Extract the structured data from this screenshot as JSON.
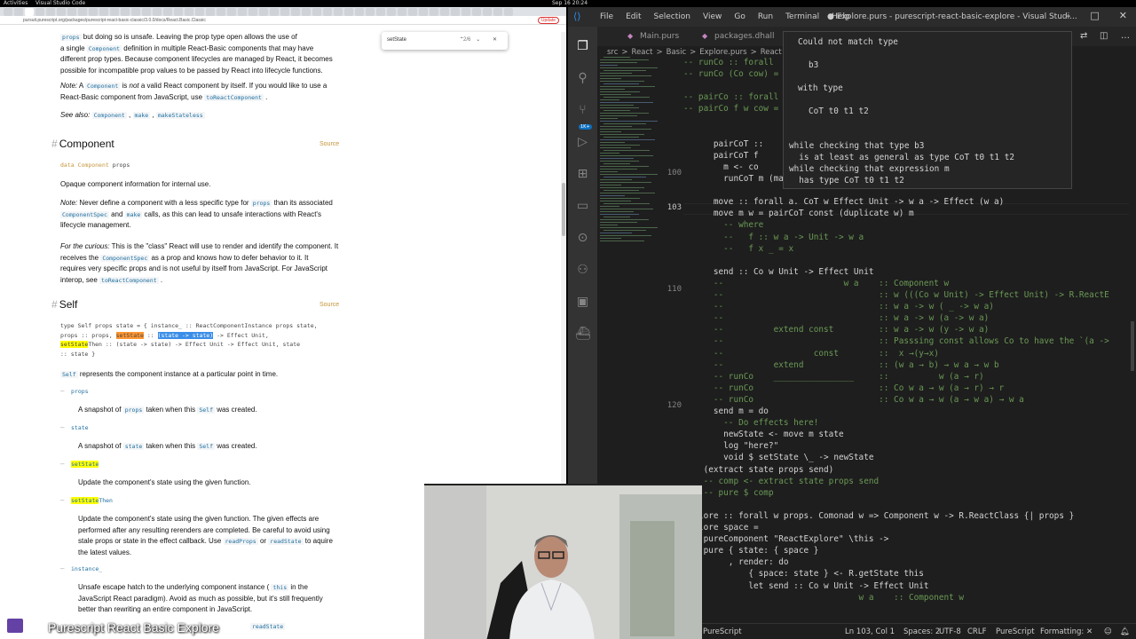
{
  "topbar": {
    "activities": "Activities",
    "app": "Visual Studio Code",
    "clock": "Sep 16 20:24"
  },
  "browser": {
    "url": "pursuit.purescript.org/packages/purescript-react-basic-classic/3.0.0/docs/React.Basic.Classic",
    "update_label": "Update",
    "find": {
      "query": "setState",
      "count": "2/6",
      "controls": "⌃ ⌄ ✕"
    },
    "intro": {
      "line1_pre": "Component ",
      "line1_code": "props",
      "line1_post": " but doing so is unsafe. Leaving the prop type open allows the use of",
      "line2_pre": "a single ",
      "line2_code": "Component",
      "line2_post": " definition in multiple React-Basic components that may have",
      "line3": "different prop types. Because component lifecycles are managed by React, it becomes",
      "line4": "possible for incompatible prop values to be passed by React into lifecycle functions.",
      "note_label": "Note:",
      "note_a": " A ",
      "note_code1": "Component",
      "note_b": " is ",
      "note_not": "not",
      "note_c": " a valid React component by itself. If you would like to use a",
      "note_line2_pre": "React-Basic component from JavaScript, use ",
      "note_code2": "toReactComponent",
      "note_line2_post": " .",
      "seealso_label": "See also:",
      "seealso_1": "Component",
      "seealso_2": "make",
      "seealso_3": "makeStateless"
    },
    "component_section": {
      "heading": "Component",
      "source": "Source",
      "sig_data": "data",
      "sig_name": "Component",
      "sig_arg": "props",
      "desc": "Opaque component information for internal use.",
      "note_label": "Note:",
      "note_l1_pre": " Never define a component with a less specific type for ",
      "note_l1_code": "props",
      "note_l1_post": " than its associated",
      "note_l2_code1": "ComponentSpec",
      "note_l2_mid": " and ",
      "note_l2_code2": "make",
      "note_l2_post": " calls, as this can lead to unsafe interactions with React's",
      "note_l3": "lifecycle management.",
      "curious_label": "For the curious:",
      "curious_l1": " This is the \"class\" React will use to render and identify the component. It",
      "curious_l2_pre": "receives the ",
      "curious_l2_code": "ComponentSpec",
      "curious_l2_post": " as a prop and knows how to defer behavior to it. It",
      "curious_l3": "requires very specific props and is not useful by itself from JavaScript. For JavaScript",
      "curious_l4_pre": "interop, see ",
      "curious_l4_code": "toReactComponent",
      "curious_l4_post": " ."
    },
    "self_section": {
      "heading": "Self",
      "source": "Source",
      "sig_l1": "type Self props state = { instance_ :: ReactComponentInstance props state,",
      "sig_l2_pre": "  props :: props, ",
      "sig_l2_hl": "setState",
      "sig_l2_mid": " :: ",
      "sig_l2_sel": "(state -> state)",
      "sig_l2_post": " -> Effect Unit,",
      "sig_l3_yl": "setState",
      "sig_l3_post": "Then :: (state -> state) -> Effect Unit -> Effect Unit, state",
      "sig_l4": "  :: state }",
      "desc_code": "Self",
      "desc": " represents the component instance at a particular point in time.",
      "fields": [
        {
          "name": "props",
          "desc_pre": "A snapshot of ",
          "desc_code": "props",
          "desc_mid": " taken when this ",
          "desc_code2": "Self",
          "desc_post": " was created."
        },
        {
          "name": "state",
          "desc_pre": "A snapshot of ",
          "desc_code": "state",
          "desc_mid": " taken when this ",
          "desc_code2": "Self",
          "desc_post": " was created."
        },
        {
          "name": "setState",
          "desc": "Update the component's state using the given function."
        },
        {
          "name": "setStateThen",
          "desc_l1": "Update the component's state using the given function. The given effects are",
          "desc_l2": "performed after any resulting rerenders are completed. Be careful to avoid using",
          "desc_l3_pre": "stale props or state in the effect callback. Use ",
          "desc_l3_code1": "readProps",
          "desc_l3_mid": " or ",
          "desc_l3_code2": "readState",
          "desc_l3_post": " to aquire",
          "desc_l4": "the latest values."
        },
        {
          "name": "instance_",
          "desc_l1_pre": "Unsafe escape hatch to the underlying component instance ( ",
          "desc_l1_code": "this",
          "desc_l1_post": " in the",
          "desc_l2": "JavaScript React paradigm). Avoid as much as possible, but it's still frequently",
          "desc_l3": "better than rewriting an entire component in JavaScript."
        }
      ],
      "see_also_tail": "readState"
    }
  },
  "caption": "Purescript React Basic Explore",
  "vscode": {
    "menu": [
      "File",
      "Edit",
      "Selection",
      "View",
      "Go",
      "Run",
      "Terminal",
      "Help"
    ],
    "title": "● Explore.purs - purescript-react-basic-explore - Visual Studi...",
    "tabs": [
      "Main.purs",
      "packages.dhall",
      "S"
    ],
    "breadcrumb": [
      "src",
      ">",
      "React",
      ">",
      "Basic",
      ">",
      "Explore.purs",
      ">",
      "React"
    ],
    "badge": "1K+",
    "line_numbers": [
      "100",
      "103",
      "110",
      "120"
    ],
    "code": [
      {
        "c": "cm",
        "t": "-- runCo :: forall"
      },
      {
        "c": "cm",
        "t": "-- runCo (Co cow) ="
      },
      {
        "c": "",
        "t": ""
      },
      {
        "c": "cm",
        "t": "-- pairCo :: forall"
      },
      {
        "c": "cm",
        "t": "-- pairCo f w cow ="
      },
      {
        "c": "",
        "t": ""
      },
      {
        "c": "",
        "t": ""
      },
      {
        "c": "",
        "t": "      pairCoT ::                                         . (a -> b ->"
      },
      {
        "c": "",
        "t": "      pairCoT f"
      },
      {
        "c": "",
        "t": "        m <- co"
      },
      {
        "c": "",
        "t": "        runCoT m (map f w)"
      },
      {
        "c": "",
        "t": ""
      },
      {
        "c": "",
        "t": "      move :: forall a. CoT w Effect Unit -> w a -> Effect (w a)"
      },
      {
        "c": "",
        "t": "      move m w = pairCoT const (duplicate w) m"
      },
      {
        "c": "cm",
        "t": "        -- where"
      },
      {
        "c": "cm",
        "t": "        --   f :: w a -> Unit -> w a"
      },
      {
        "c": "cm",
        "t": "        --   f x _ = x"
      },
      {
        "c": "",
        "t": ""
      },
      {
        "c": "",
        "t": "      send :: Co w Unit -> Effect Unit"
      },
      {
        "c": "cm",
        "t": "      --                        w a    :: Component w"
      },
      {
        "c": "cm",
        "t": "      --                               :: w (((Co w Unit) -> Effect Unit) -> R.ReactE"
      },
      {
        "c": "cm",
        "t": "      --                               :: w a -> w ( _ -> w a)"
      },
      {
        "c": "cm",
        "t": "      --                               :: w a -> w (a -> w a)"
      },
      {
        "c": "cm",
        "t": "      --          extend const         :: w a -> w (y -> w a)"
      },
      {
        "c": "cm",
        "t": "      --                               :: Passsing const allows Co to have the `(a ->"
      },
      {
        "c": "cm",
        "t": "      --                  const        ::  x →(y→x)"
      },
      {
        "c": "cm",
        "t": "      --          extend               :: (w a → b) → w a → w b"
      },
      {
        "c": "cm",
        "t": "      -- runCo    ________________     ::          w (a → r)"
      },
      {
        "c": "cm",
        "t": "      -- runCo                         :: Co w a → w (a → r) → r"
      },
      {
        "c": "cm",
        "t": "      -- runCo                         :: Co w a → w (a → w a) → w a"
      },
      {
        "c": "",
        "t": "      send m = do"
      },
      {
        "c": "cm",
        "t": "        -- Do effects here!"
      },
      {
        "c": "",
        "t": "        newState <- move m state"
      },
      {
        "c": "",
        "t": "        log \"here?\""
      },
      {
        "c": "",
        "t": "        void $ setState \\_ -> newState"
      },
      {
        "c": "",
        "t": "    (extract state props send)"
      },
      {
        "c": "cm",
        "t": "    -- comp <- extract state props send"
      },
      {
        "c": "cm",
        "t": "    -- pure $ comp"
      },
      {
        "c": "",
        "t": ""
      },
      {
        "c": "",
        "t": "explore :: forall w props. Comonad w => Component w -> R.ReactClass {| props }"
      },
      {
        "c": "",
        "t": "explore space ="
      },
      {
        "c": "",
        "t": "  R.pureComponent \"ReactExplore\" \\this ->"
      },
      {
        "c": "",
        "t": "    pure { state: { space }"
      },
      {
        "c": "",
        "t": "         , render: do"
      },
      {
        "c": "",
        "t": "             { space: state } <- R.getState this"
      },
      {
        "c": "",
        "t": "             let send :: Co w Unit -> Effect Unit"
      },
      {
        "c": "cm",
        "t": "                                   w a    :: Component w"
      }
    ],
    "hover": {
      "l1": "Could not match type",
      "l2": "b3",
      "l3": "with type",
      "l4": "CoT t0 t1 t2",
      "l5": "while checking that type b3",
      "l6": "  is at least as general as type CoT t0 t1 t2",
      "l7": "while checking that expression m",
      "l8": "  has type CoT t0 t1 t2"
    },
    "status": {
      "lang_left": "PureScript",
      "pos": "Ln 103, Col 1",
      "spaces": "Spaces: 2",
      "enc": "UTF-8",
      "eol": "CRLF",
      "lang": "PureScript",
      "fmt": "Formatting: ✕"
    }
  }
}
